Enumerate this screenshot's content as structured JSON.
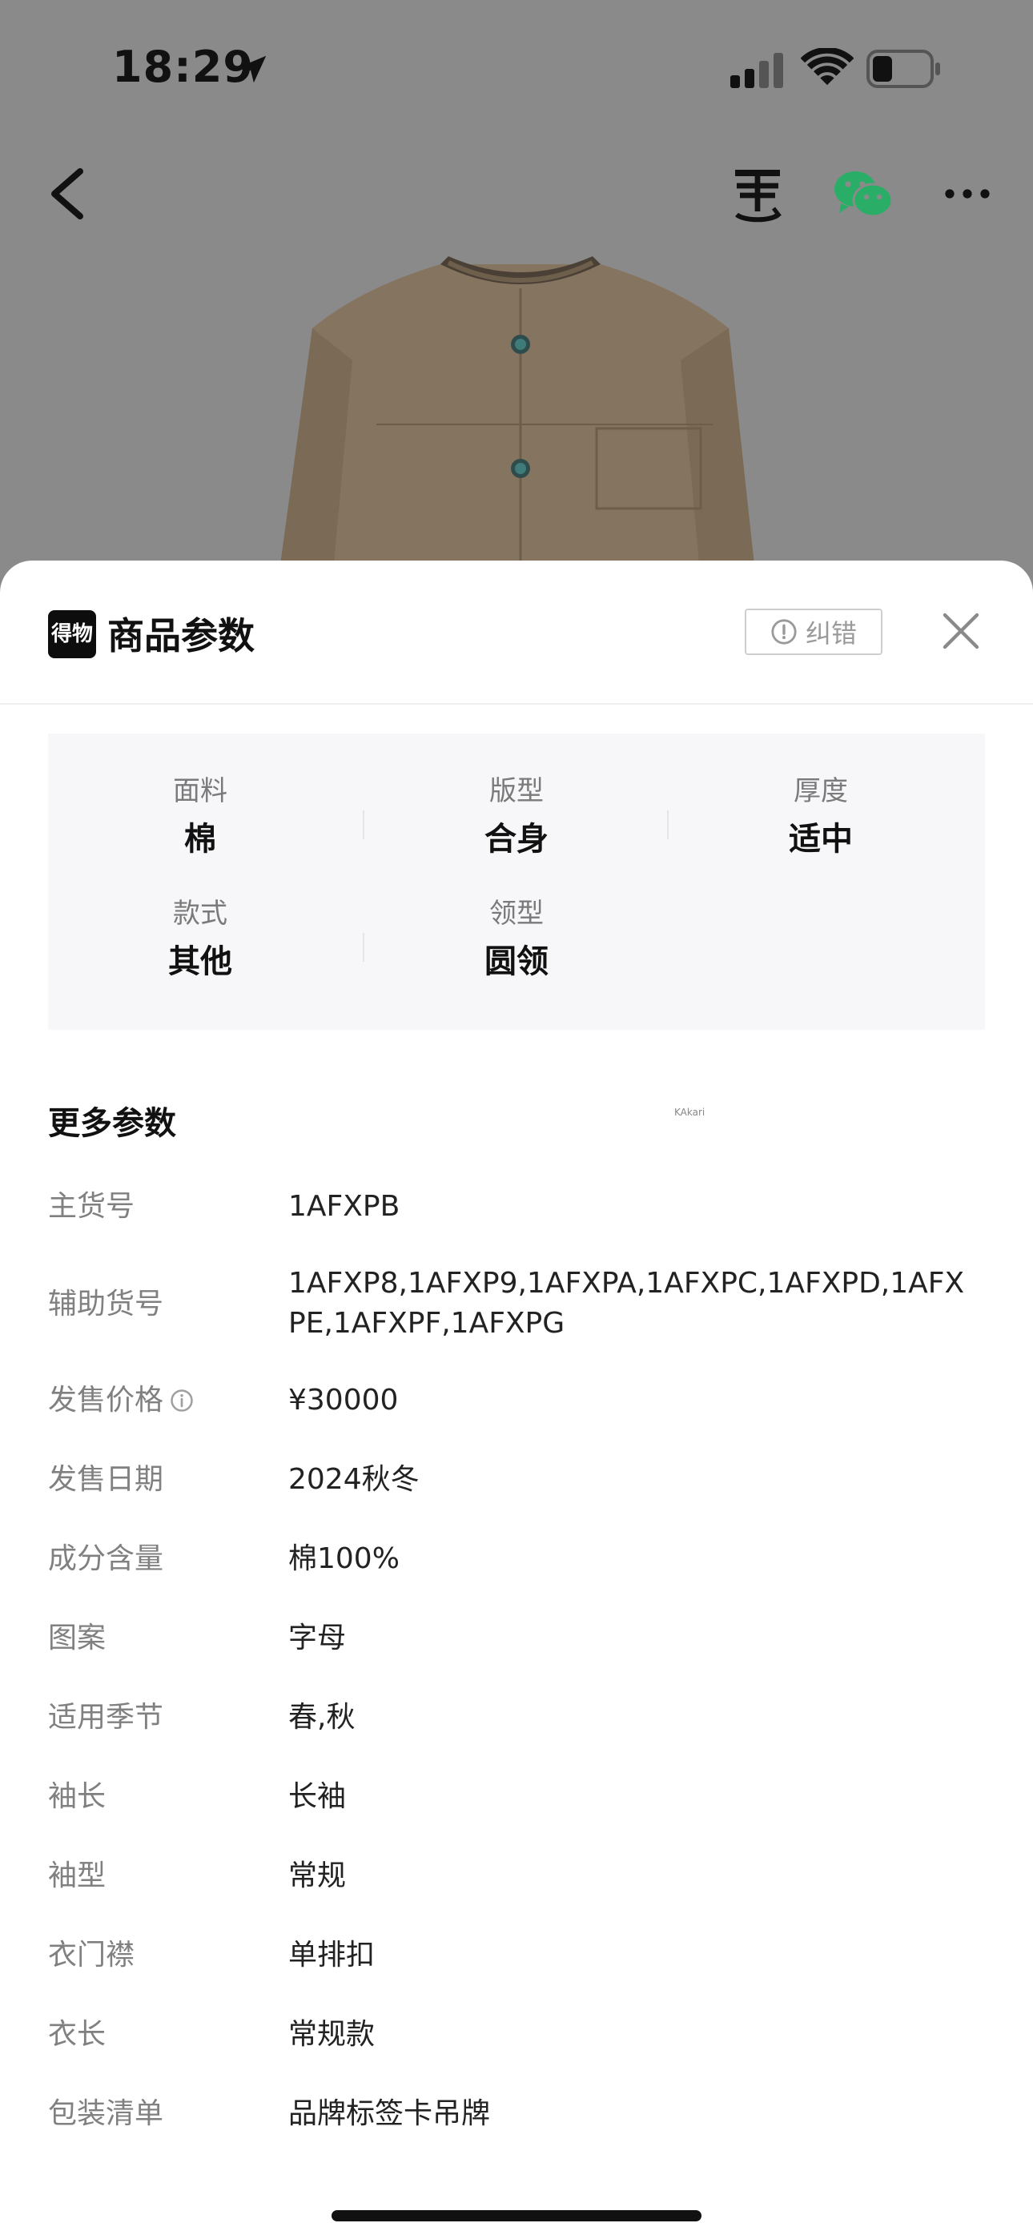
{
  "status_bar": {
    "time": "18:29"
  },
  "sheet": {
    "logo_text": "得物",
    "title": "商品参数",
    "report_label": "纠错"
  },
  "key_params": [
    {
      "label": "面料",
      "value": "棉"
    },
    {
      "label": "版型",
      "value": "合身"
    },
    {
      "label": "厚度",
      "value": "适中"
    },
    {
      "label": "款式",
      "value": "其他"
    },
    {
      "label": "领型",
      "value": "圆领"
    }
  ],
  "more_params": {
    "title": "更多参数",
    "rows": [
      {
        "label": "主货号",
        "value": "1AFXPB"
      },
      {
        "label": "辅助货号",
        "value": "1AFXP8,1AFXP9,1AFXPA,1AFXPC,1AFXPD,1AFXPE,1AFXPF,1AFXPG"
      },
      {
        "label": "发售价格",
        "value": "¥30000"
      },
      {
        "label": "发售日期",
        "value": "2024秋冬"
      },
      {
        "label": "成分含量",
        "value": "棉100%"
      },
      {
        "label": "图案",
        "value": "字母"
      },
      {
        "label": "适用季节",
        "value": "春,秋"
      },
      {
        "label": "袖长",
        "value": "长袖"
      },
      {
        "label": "袖型",
        "value": "常规"
      },
      {
        "label": "衣门襟",
        "value": "单排扣"
      },
      {
        "label": "衣长",
        "value": "常规款"
      },
      {
        "label": "包装清单",
        "value": "品牌标签卡吊牌"
      }
    ]
  },
  "watermark": "KAkari",
  "icons": [
    "location-arrow-icon",
    "signal-icon",
    "wifi-icon",
    "battery-icon",
    "back-icon",
    "sell-icon",
    "wechat-icon",
    "more-icon",
    "info-icon",
    "close-icon"
  ],
  "colors": {
    "accent_wechat": "#2aae67",
    "backdrop": "#8a8a8a",
    "label_gray": "#808080"
  }
}
